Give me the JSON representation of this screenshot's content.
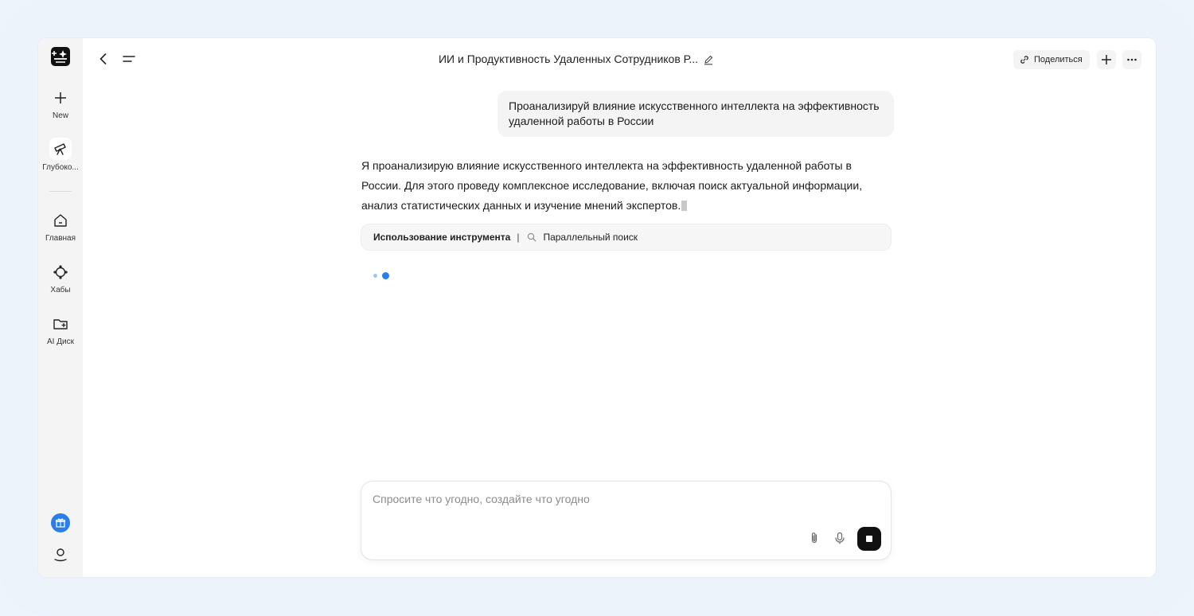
{
  "sidebar": {
    "items": [
      {
        "label": "New",
        "icon": "plus-icon"
      },
      {
        "label": "Глубоко...",
        "icon": "telescope-icon"
      },
      {
        "label": "Главная",
        "icon": "home-icon"
      },
      {
        "label": "Хабы",
        "icon": "hub-icon"
      },
      {
        "label": "AI Диск",
        "icon": "folder-icon"
      }
    ],
    "gift_color": "#2b7de9"
  },
  "header": {
    "title": "ИИ и Продуктивность Удаленных Сотрудников Р...",
    "share_label": "Поделиться"
  },
  "chat": {
    "user_message": "Проанализируй влияние искусственного интеллекта на эффективность удаленной работы в России",
    "assistant_message": "Я проанализирую влияние искусственного интеллекта на эффективность удаленной работы в России. Для этого проведу комплексное исследование, включая поиск актуальной информации, анализ статистических данных и изучение мнений экспертов.",
    "tool_usage_label": "Использование инструмента",
    "tool_separator": "|",
    "tool_name": "Параллельный поиск"
  },
  "input": {
    "placeholder": "Спросите что угодно, создайте что угодно"
  },
  "colors": {
    "accent": "#2b7de9",
    "sidebar_bg": "#f4f4f5"
  }
}
